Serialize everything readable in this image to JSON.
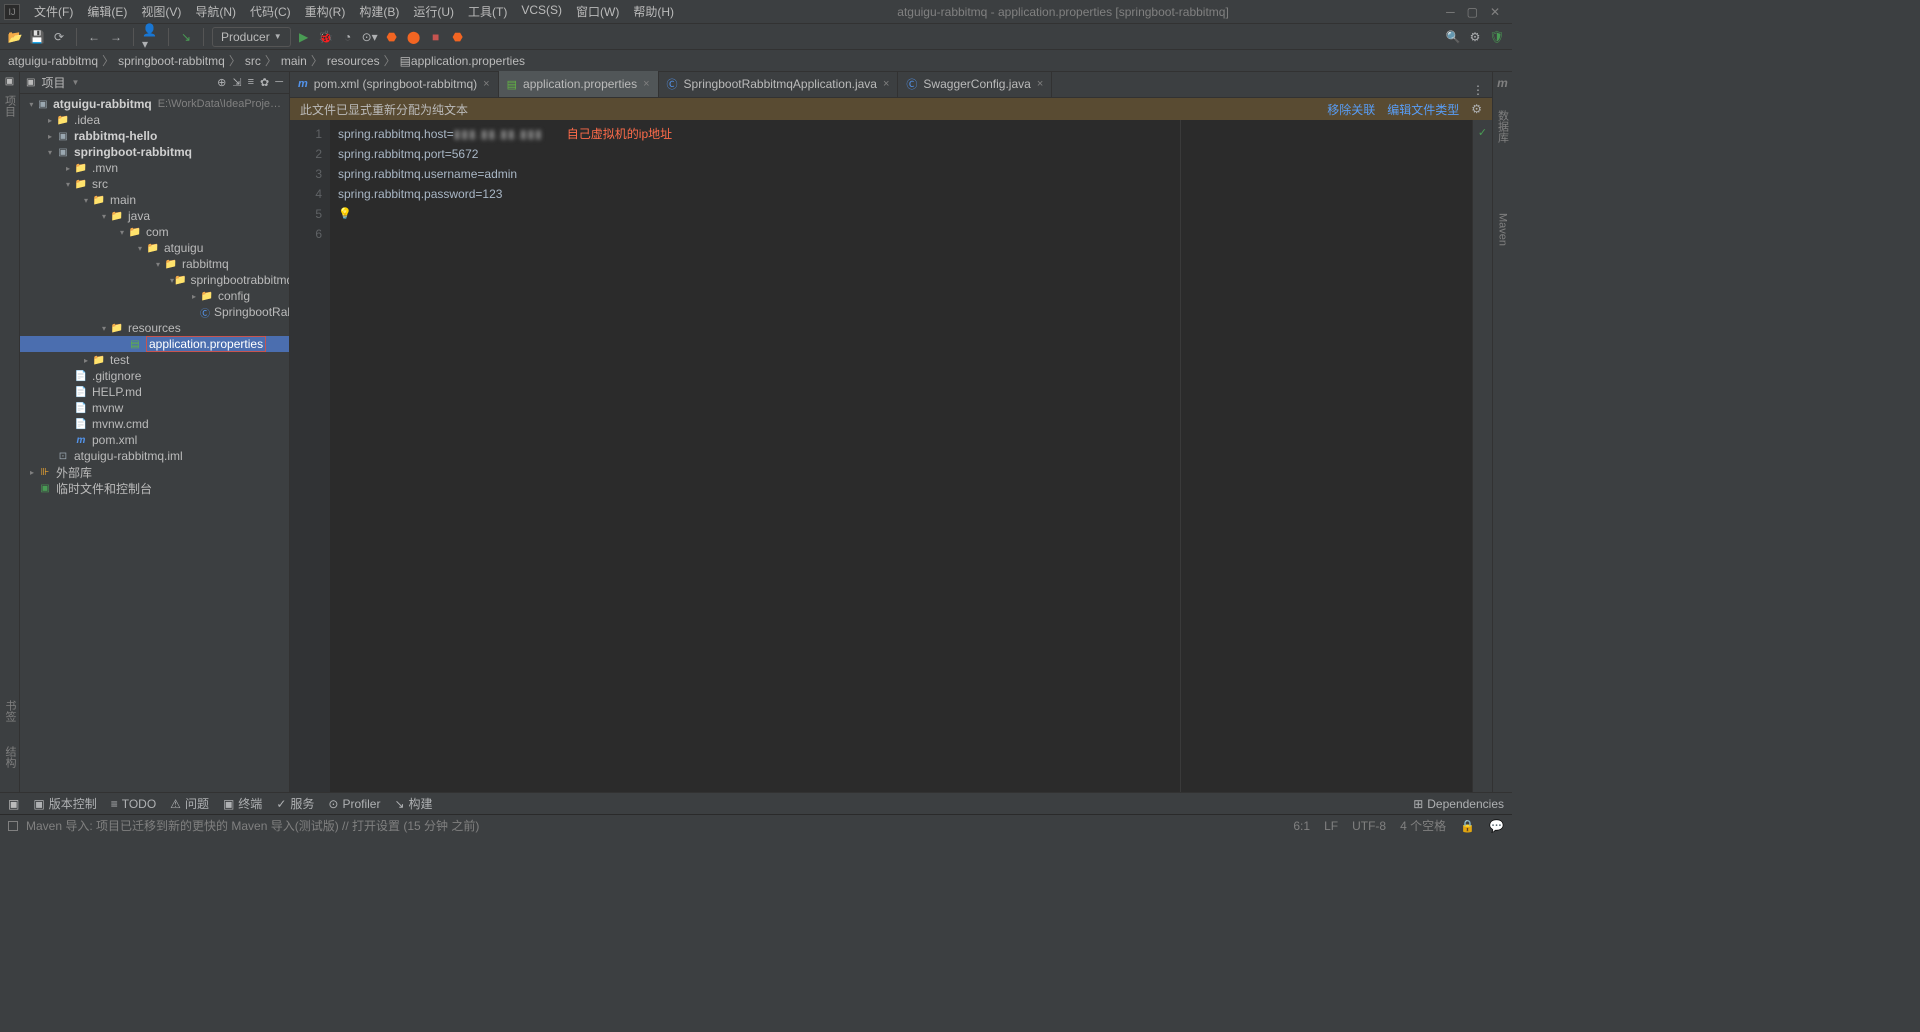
{
  "titlebar": {
    "title": "atguigu-rabbitmq - application.properties [springboot-rabbitmq]",
    "menu": [
      "文件(F)",
      "编辑(E)",
      "视图(V)",
      "导航(N)",
      "代码(C)",
      "重构(R)",
      "构建(B)",
      "运行(U)",
      "工具(T)",
      "VCS(S)",
      "窗口(W)",
      "帮助(H)"
    ]
  },
  "toolbar": {
    "runConfig": "Producer"
  },
  "breadcrumb": [
    "atguigu-rabbitmq",
    "springboot-rabbitmq",
    "src",
    "main",
    "resources",
    "application.properties"
  ],
  "sidebar": {
    "title": "项目",
    "tree": {
      "root": {
        "label": "atguigu-rabbitmq",
        "path": "E:\\WorkData\\IdeaProjects\\Ra"
      },
      "idea": ".idea",
      "hello": "rabbitmq-hello",
      "springboot": "springboot-rabbitmq",
      "mvn": ".mvn",
      "src": "src",
      "main": "main",
      "java": "java",
      "com": "com",
      "atguigu": "atguigu",
      "rabbitmq": "rabbitmq",
      "sbr": "springbootrabbitmq",
      "config": "config",
      "app": "SpringbootRabbitmqAp",
      "resources": "resources",
      "appprops": "application.properties",
      "test": "test",
      "gitignore": ".gitignore",
      "help": "HELP.md",
      "mvnw": "mvnw",
      "mvnwcmd": "mvnw.cmd",
      "pom": "pom.xml",
      "iml": "atguigu-rabbitmq.iml",
      "external": "外部库",
      "scratch": "临时文件和控制台"
    }
  },
  "tabs": [
    {
      "icon": "m",
      "label": "pom.xml (springboot-rabbitmq)",
      "active": false
    },
    {
      "icon": "p",
      "label": "application.properties",
      "active": true
    },
    {
      "icon": "j",
      "label": "SpringbootRabbitmqApplication.java",
      "active": false
    },
    {
      "icon": "j",
      "label": "SwaggerConfig.java",
      "active": false
    }
  ],
  "notice": {
    "text": "此文件已显式重新分配为纯文本",
    "actions": [
      "移除关联",
      "编辑文件类型"
    ]
  },
  "code": {
    "lines": [
      {
        "n": 1,
        "text": "spring.rabbitmq.host=",
        "suffix": "",
        "blur": "▮▮▮.▮▮.▮▮.▮▮▮",
        "red": "自己虚拟机的ip地址"
      },
      {
        "n": 2,
        "text": "spring.rabbitmq.port=5672"
      },
      {
        "n": 3,
        "text": "spring.rabbitmq.username=admin"
      },
      {
        "n": 4,
        "text": "spring.rabbitmq.password=123"
      },
      {
        "n": 5,
        "text": "",
        "bulb": true
      },
      {
        "n": 6,
        "text": ""
      }
    ]
  },
  "leftVertical": [
    "项目",
    "结构"
  ],
  "rightVertical": [
    "数据库",
    "Maven"
  ],
  "bottom": {
    "items": [
      "版本控制",
      "TODO",
      "问题",
      "终端",
      "服务",
      "Profiler",
      "构建",
      "Dependencies"
    ],
    "icons": [
      "▣",
      "≡",
      "⚠",
      "▣",
      "✓",
      "⊙",
      "↘",
      "⊞"
    ]
  },
  "leftBottomVert": [
    "书签",
    "结构"
  ],
  "status": {
    "msg": "Maven 导入: 项目已迁移到新的更快的 Maven 导入(测试版) // 打开设置 (15 分钟 之前)",
    "right": [
      "6:1",
      "LF",
      "UTF-8",
      "4 个空格"
    ]
  }
}
